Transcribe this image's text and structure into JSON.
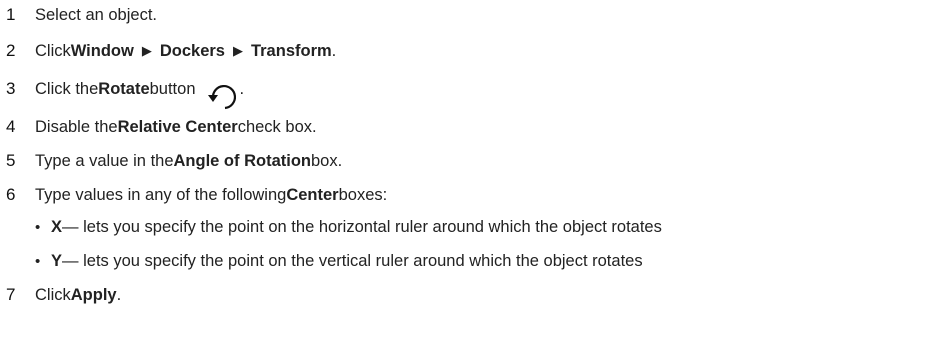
{
  "steps": [
    {
      "num": "1",
      "text": "Select an object."
    },
    {
      "num": "2",
      "pre": "Click ",
      "item1": "Window",
      "item2": "Dockers",
      "item3": "Transform",
      "post": "."
    },
    {
      "num": "3",
      "pre": "Click the ",
      "bold": "Rotate",
      "post": " button",
      "tail": ".",
      "icon": "rotate-icon"
    },
    {
      "num": "4",
      "pre": "Disable the ",
      "bold": "Relative Center",
      "post": " check box."
    },
    {
      "num": "5",
      "pre": "Type a value in the ",
      "bold": "Angle of Rotation",
      "post": " box."
    },
    {
      "num": "6",
      "pre": "Type values in any of the following ",
      "bold": "Center",
      "post": " boxes:"
    },
    {
      "num": "7",
      "pre": "Click ",
      "bold": "Apply",
      "post": "."
    }
  ],
  "bullets": [
    {
      "marker": "•",
      "bold": "X",
      "text": " — lets you specify the point on the horizontal ruler around which the object rotates"
    },
    {
      "marker": "•",
      "bold": "Y",
      "text": " — lets you specify the point on the vertical ruler around which the object rotates"
    }
  ],
  "menu_arrow": "▶"
}
